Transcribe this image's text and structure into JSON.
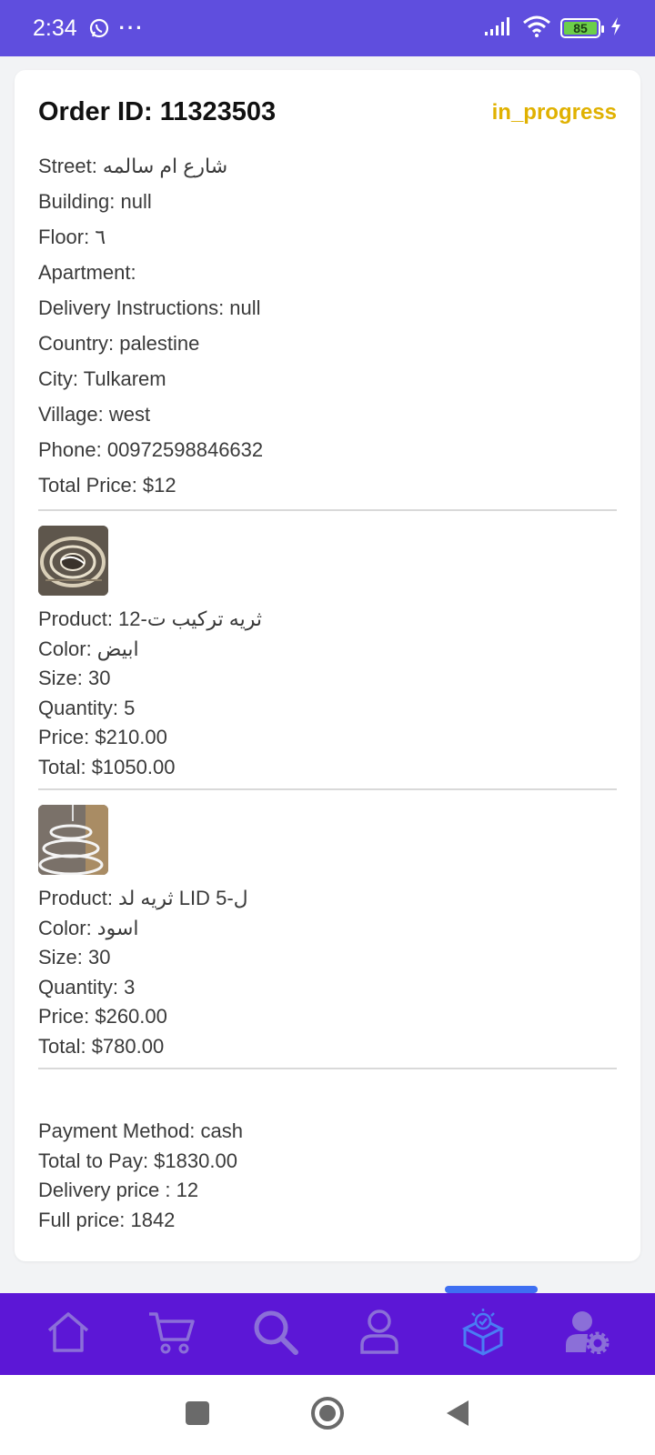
{
  "status_bar": {
    "time": "2:34",
    "dots": "···",
    "battery": "85"
  },
  "order": {
    "id_text": "Order ID: 11323503",
    "status": "in_progress",
    "status_color": "#e0b100",
    "address_rows": [
      "Street: شارع ام سالمه",
      "Building: null",
      "Floor: ٦",
      "Apartment:",
      "Delivery Instructions: null",
      "Country: palestine",
      "City: Tulkarem",
      "Village: west",
      "Phone: 00972598846632",
      "Total Price: $12"
    ]
  },
  "products": [
    {
      "product": "Product: ثريه تركيب ت-12",
      "color": "Color: ابيض",
      "size": "Size: 30",
      "quantity": "Quantity: 5",
      "price": "Price: $210.00",
      "total": "Total: $1050.00"
    },
    {
      "product": "Product: ثريه لد LID  ل-5",
      "color": "Color: اسود",
      "size": "Size: 30",
      "quantity": "Quantity: 3",
      "price": "Price: $260.00",
      "total": "Total: $780.00"
    }
  ],
  "summary": {
    "payment_method": "Payment Method: cash",
    "total_to_pay": "Total to Pay: $1830.00",
    "delivery_price": "Delivery price : 12",
    "full_price": "Full price: 1842"
  },
  "bottom_nav": {
    "items": [
      "home-icon",
      "cart-icon",
      "search-icon",
      "profile-icon",
      "orders-icon",
      "user-settings-icon"
    ],
    "active": "orders-icon",
    "background": "#5c17d6",
    "inactive_color": "#8b6fd8",
    "active_color": "#4a7cf4"
  },
  "colors": {
    "status_bar": "#5f4ede",
    "page_background": "#f2f3f5"
  }
}
